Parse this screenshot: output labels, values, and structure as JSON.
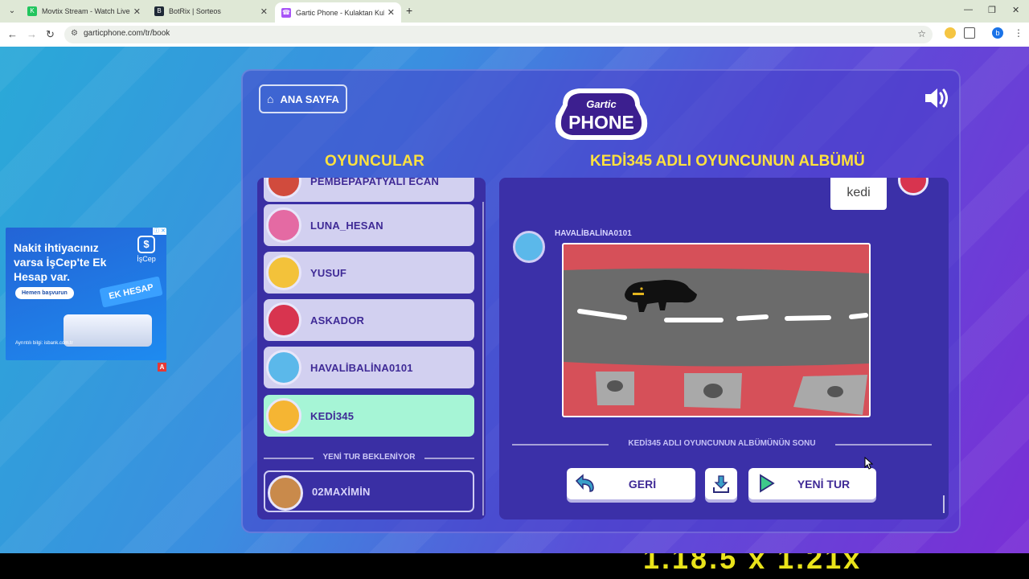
{
  "browser": {
    "tabs": [
      {
        "title": "Movtix Stream - Watch Live on",
        "favicon_color": "#22c55e",
        "favicon_letter": "K"
      },
      {
        "title": "BotRix | Sorteos",
        "favicon_color": "#1f2937",
        "favicon_letter": "B"
      },
      {
        "title": "Gartic Phone - Kulaktan Kulağa",
        "favicon_color": "#a855f7",
        "favicon_letter": "☎"
      }
    ],
    "active_tab": 2,
    "url": "garticphone.com/tr/book",
    "profile_initial": "b"
  },
  "ad": {
    "headline": "Nakit ihtiyacınız varsa İşCep'te Ek Hesap var.",
    "cta": "Hemen başvurun",
    "brand": "İşCep",
    "badge": "EK HESAP",
    "footer": "Ayrıntılı bilgi: isbank.com.tr"
  },
  "game": {
    "home_label": "ANA SAYFA",
    "logo_top": "Gartic",
    "logo_bottom": "PHONE",
    "players_title": "OYUNCULAR",
    "album_title": "KEDİ345 ADLI OYUNCUNUN ALBÜMÜ",
    "players": [
      {
        "name": "PEMBEPAPATYALI ECAN",
        "avatar_color": "#d14b3d"
      },
      {
        "name": "LUNA_HESAN",
        "avatar_color": "#e46aa3"
      },
      {
        "name": "YUSUF",
        "avatar_color": "#f3c23a"
      },
      {
        "name": "ASKADOR",
        "avatar_color": "#d8344f"
      },
      {
        "name": "HAVALİBALİNA0101",
        "avatar_color": "#5bb8ea"
      },
      {
        "name": "KEDİ345",
        "avatar_color": "#f5b533"
      }
    ],
    "active_player": "KEDİ345",
    "waiting_label": "YENİ TUR BEKLENİYOR",
    "waiting_player": {
      "name": "02MAXİMİN",
      "avatar_color": "#c98a4b"
    },
    "album": {
      "prompt_text": "kedi",
      "drawer": "HAVALİBALİNA0101",
      "end_label": "KEDİ345 ADLI OYUNCUNUN ALBÜMÜNÜN SONU",
      "back_label": "GERİ",
      "new_round_label": "YENİ TUR"
    }
  },
  "subtitle": "1.18.5 x 1.21x",
  "colors": {
    "accent_yellow": "#ffe23d",
    "panel": "#3a2fa4",
    "active_green": "#a6f5d6"
  }
}
